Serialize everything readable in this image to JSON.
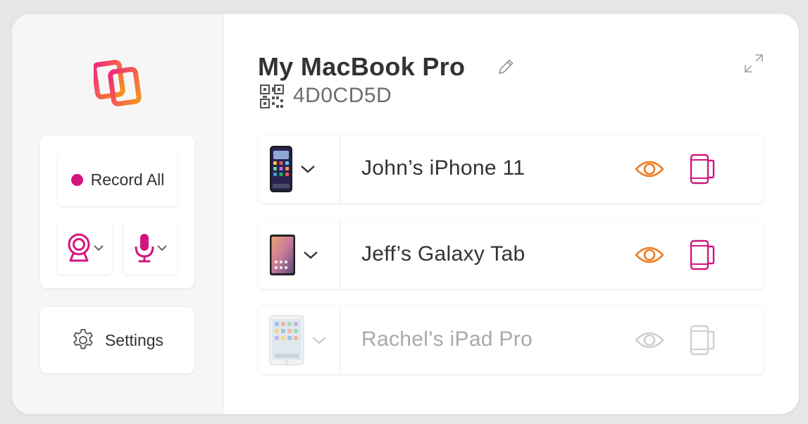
{
  "sidebar": {
    "logo": "app-logo",
    "record_all_label": "Record All",
    "camera_icon": "webcam-icon",
    "mic_icon": "microphone-icon",
    "settings_label": "Settings"
  },
  "header": {
    "title": "My MacBook Pro",
    "code": "4D0CD5D"
  },
  "devices": [
    {
      "name": "John’s iPhone 11",
      "type": "iphone",
      "enabled": true
    },
    {
      "name": "Jeff’s Galaxy Tab",
      "type": "galaxy-tab",
      "enabled": true
    },
    {
      "name": "Rachel’s iPad Pro",
      "type": "ipad",
      "enabled": false
    }
  ],
  "colors": {
    "accent_pink": "#d4147e",
    "accent_orange": "#ec7a1c",
    "disabled": "#c9c9c9"
  }
}
